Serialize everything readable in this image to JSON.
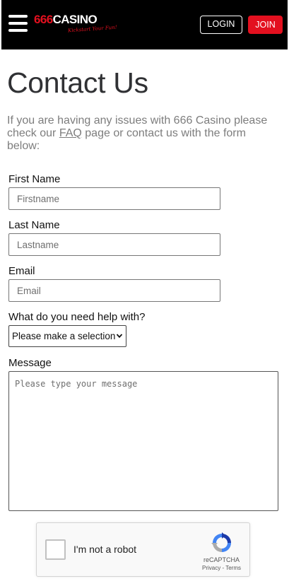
{
  "header": {
    "logo_main_a": "666",
    "logo_main_b": "CASINO",
    "logo_tagline": "Kickstart Your Fun!",
    "login_label": "LOGIN",
    "join_label": "JOIN",
    "colors": {
      "background": "#000000",
      "accent": "#e3101f"
    }
  },
  "page": {
    "title": "Contact Us",
    "intro_before": "If you are having any issues with 666 Casino please check our ",
    "intro_link": "FAQ",
    "intro_after": " page or contact us with the form below:"
  },
  "form": {
    "first_name": {
      "label": "First Name",
      "placeholder": "Firstname",
      "value": ""
    },
    "last_name": {
      "label": "Last Name",
      "placeholder": "Lastname",
      "value": ""
    },
    "email": {
      "label": "Email",
      "placeholder": "Email",
      "value": ""
    },
    "help_topic": {
      "label": "What do you need help with?",
      "selected": "Please make a selection"
    },
    "message": {
      "label": "Message",
      "placeholder": "Please type your message",
      "value": ""
    }
  },
  "recaptcha": {
    "checkbox_label": "I'm not a robot",
    "brand": "reCAPTCHA",
    "privacy": "Privacy",
    "separator": " - ",
    "terms": "Terms"
  },
  "icons": {
    "menu": "hamburger-menu-icon",
    "select": "chevron-down-icon",
    "recaptcha": "recaptcha-logo-icon"
  }
}
